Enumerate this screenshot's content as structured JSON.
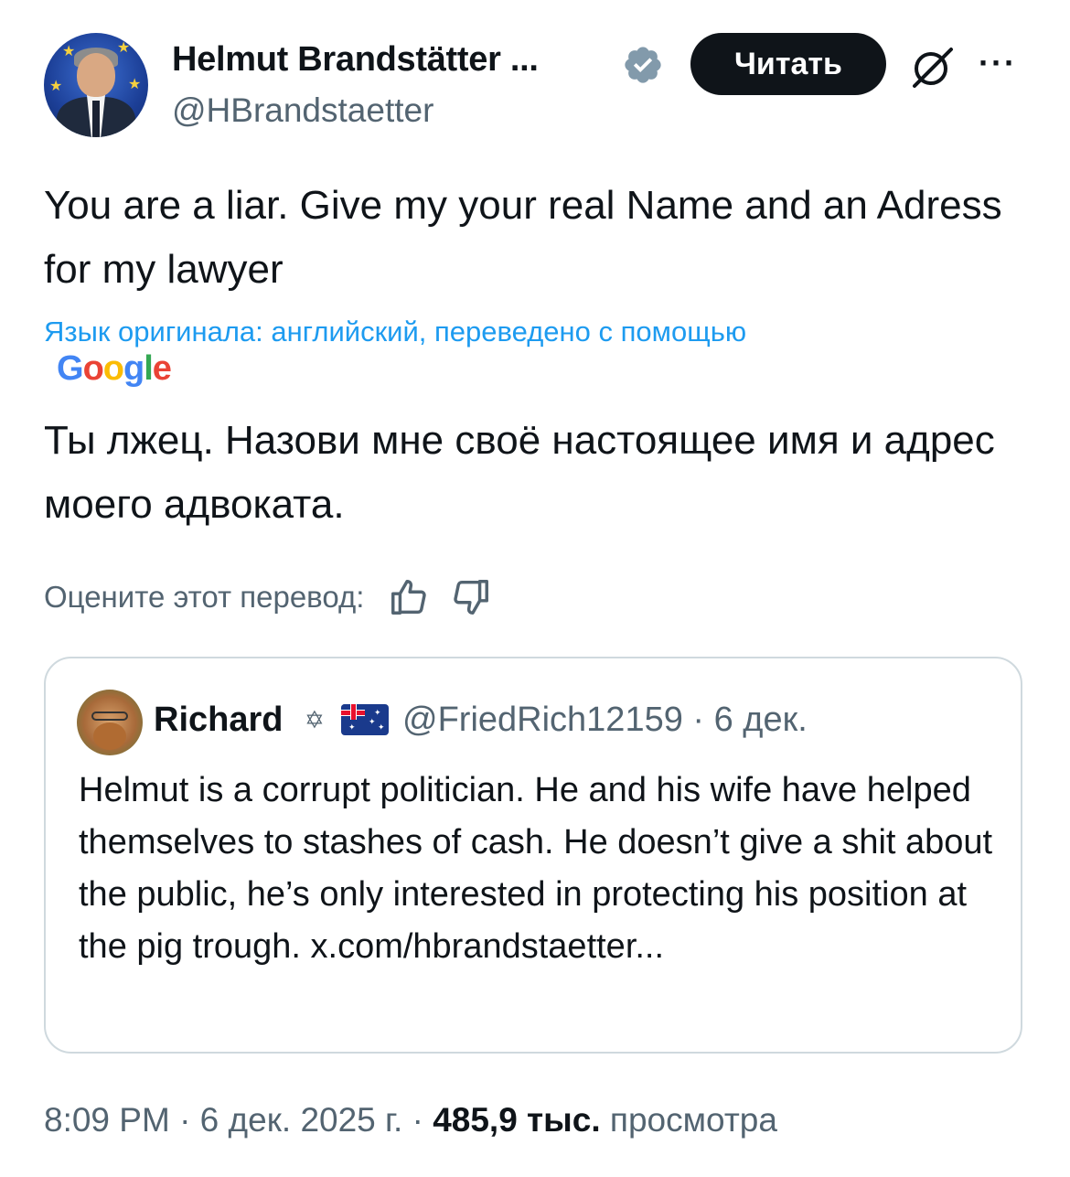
{
  "author": {
    "display_name": "Helmut Brandstätter ...",
    "handle": "@HBrandstaetter",
    "verified_icon": "verified-badge-icon",
    "follow_label": "Читать"
  },
  "tweet": {
    "text": "You are a liar. Give my your real Name and an Adress for my lawyer",
    "translation_note": "Язык оригинала: английский, переведено с помощью",
    "translation_provider": "Google",
    "translated_text": "Ты лжец. Назови мне своё настоящее имя и адрес моего адвоката.",
    "rate_prompt": "Оцените этот перевод:"
  },
  "quoted_tweet": {
    "display_name": "Richard",
    "name_symbol": "✡",
    "flag": "Australia",
    "handle_date": "@FriedRich12159 · 6 дек.",
    "text": "Helmut is a corrupt politician. He and his wife have helped themselves to stashes of cash. He doesn’t give a shit about the public, he’s only interested in protecting his position at the pig trough. x.com/hbrandstaetter..."
  },
  "footer": {
    "time_date": "8:09 PM · 6 дек. 2025 г. · ",
    "views_count": "485,9 тыс.",
    "views_label": " просмотра"
  },
  "colors": {
    "text_primary": "#0f1419",
    "text_secondary": "#536471",
    "link_blue": "#1d9bf0",
    "verified_blue": "#829aab",
    "border": "#cfd9de"
  }
}
